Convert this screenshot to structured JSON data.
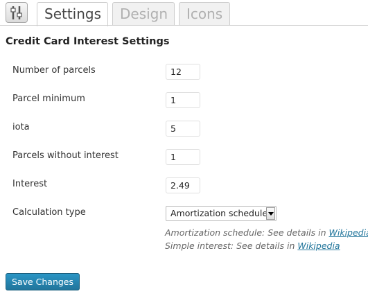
{
  "tabs": [
    {
      "label": "Settings",
      "active": true
    },
    {
      "label": "Design",
      "active": false
    },
    {
      "label": "Icons",
      "active": false
    }
  ],
  "page_title": "Credit Card Interest Settings",
  "fields": [
    {
      "label": "Number of parcels",
      "value": "12"
    },
    {
      "label": "Parcel minimum",
      "value": "1"
    },
    {
      "label": "iota",
      "value": "5"
    },
    {
      "label": "Parcels without interest",
      "value": "1"
    },
    {
      "label": "Interest",
      "value": "2.49"
    }
  ],
  "calculation": {
    "label": "Calculation type",
    "selected": "Amortization schedule"
  },
  "descriptions": [
    {
      "text": "Amortization schedule: See details in ",
      "link": "Wikipedia"
    },
    {
      "text": "Simple interest: See details in ",
      "link": "Wikipedia"
    }
  ],
  "save_label": "Save Changes",
  "colors": {
    "accent": "#21759b",
    "link": "#21759b",
    "tab_inactive_text": "#b0b0b0"
  }
}
